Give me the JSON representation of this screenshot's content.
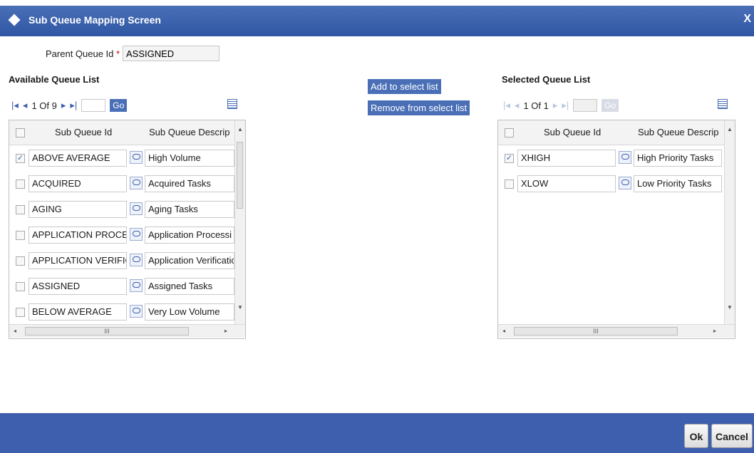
{
  "window": {
    "title": "Sub Queue Mapping Screen",
    "close_label": "X"
  },
  "parent_queue": {
    "label": "Parent Queue Id",
    "required_mark": "*",
    "value": "ASSIGNED"
  },
  "available": {
    "title": "Available Queue List",
    "page_text": "1 Of 9",
    "go_label": "Go",
    "columns": [
      "Sub Queue Id",
      "Sub Queue Descrip"
    ],
    "rows": [
      {
        "checked": true,
        "id": "ABOVE AVERAGE",
        "desc": "High Volume"
      },
      {
        "checked": false,
        "id": "ACQUIRED",
        "desc": "Acquired Tasks"
      },
      {
        "checked": false,
        "id": "AGING",
        "desc": "Aging Tasks"
      },
      {
        "checked": false,
        "id": "APPLICATION PROCES",
        "desc": "Application Processi"
      },
      {
        "checked": false,
        "id": "APPLICATION VERIFIC",
        "desc": "Application Verificatio"
      },
      {
        "checked": false,
        "id": "ASSIGNED",
        "desc": "Assigned Tasks"
      },
      {
        "checked": false,
        "id": "BELOW AVERAGE",
        "desc": "Very Low Volume"
      }
    ]
  },
  "actions": {
    "add": "Add to select list",
    "remove": "Remove from select list"
  },
  "selected": {
    "title": "Selected Queue List",
    "page_text": "1 Of 1",
    "go_label": "Go",
    "columns": [
      "Sub Queue Id",
      "Sub Queue Descrip"
    ],
    "rows": [
      {
        "checked": true,
        "id": "XHIGH",
        "desc": "High Priority Tasks"
      },
      {
        "checked": false,
        "id": "XLOW",
        "desc": "Low Priority Tasks"
      }
    ]
  },
  "scroll_glyph": "III",
  "footer": {
    "ok": "Ok",
    "cancel": "Cancel"
  }
}
